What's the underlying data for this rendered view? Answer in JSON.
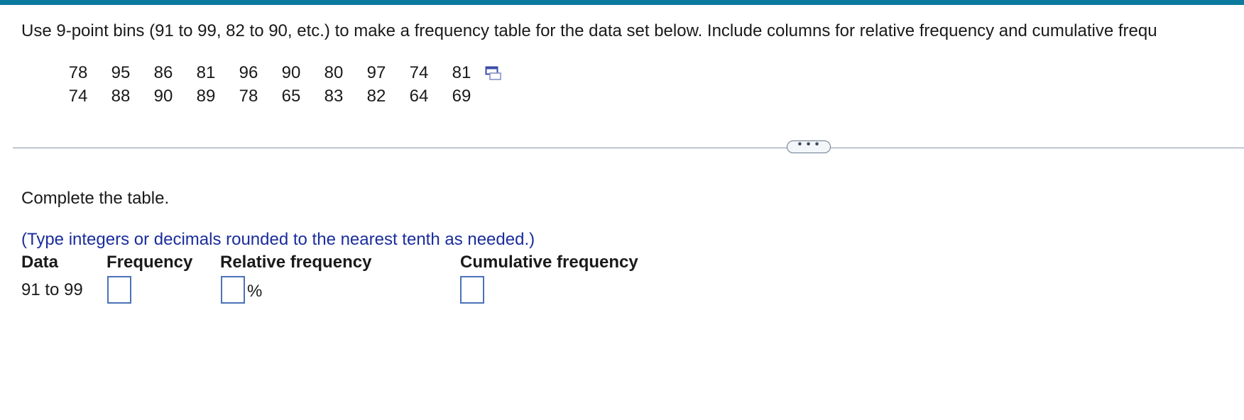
{
  "question": {
    "text": "Use 9-point bins (91 to 99, 82 to 90, etc.) to make a frequency table for the data set below. Include columns for relative frequency and cumulative frequ"
  },
  "dataset": {
    "rows": [
      [
        "78",
        "95",
        "86",
        "81",
        "96",
        "90",
        "80",
        "97",
        "74",
        "81"
      ],
      [
        "74",
        "88",
        "90",
        "89",
        "78",
        "65",
        "83",
        "82",
        "64",
        "69"
      ]
    ],
    "copy_icon": "copy-to-clipboard-icon"
  },
  "divider": {
    "more_label": "• • •"
  },
  "instruction": "Complete the table.",
  "hint": "(Type integers or decimals rounded to the nearest tenth as needed.)",
  "table": {
    "headers": {
      "data": "Data",
      "frequency": "Frequency",
      "relative_frequency": "Relative frequency",
      "cumulative_frequency": "Cumulative frequency"
    },
    "rows": [
      {
        "label": "91 to 99",
        "frequency": "",
        "relative_frequency": "",
        "relative_unit": "%",
        "cumulative_frequency": ""
      }
    ]
  },
  "colors": {
    "top_bar": "#0b7a9e",
    "hint_text": "#1a2d9c",
    "input_border": "#4a72b8"
  }
}
